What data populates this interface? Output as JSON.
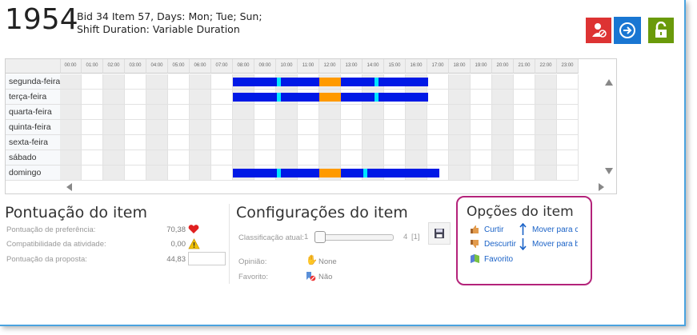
{
  "header": {
    "bid_number": "1954",
    "line1": "Bid 34 Item 57, Days: Mon; Tue; Sun;",
    "line2": "Shift Duration: Variable Duration"
  },
  "schedule": {
    "hours": [
      "00:00",
      "01:00",
      "02:00",
      "03:00",
      "04:00",
      "05:00",
      "06:00",
      "07:00",
      "08:00",
      "09:00",
      "10:00",
      "11:00",
      "12:00",
      "13:00",
      "14:00",
      "15:00",
      "16:00",
      "17:00",
      "18:00",
      "19:00",
      "20:00",
      "21:00",
      "22:00",
      "23:00"
    ],
    "days": [
      "segunda-feira",
      "terça-feira",
      "quarta-feira",
      "quinta-feira",
      "sexta-feira",
      "sábado",
      "domingo"
    ],
    "colors": {
      "work": "#0019e6",
      "break": "#00e5ff",
      "lunch": "#ff9a00"
    }
  },
  "score": {
    "title": "Pontuação do item",
    "rows": [
      {
        "label": "Pontuação de preferência:",
        "value": "70,38",
        "icon": "heart-icon"
      },
      {
        "label": "Compatibilidade da atividade:",
        "value": "0,00",
        "icon": "warning-icon"
      },
      {
        "label": "Pontuação da proposta:",
        "value": "44,83",
        "icon": ""
      }
    ]
  },
  "config": {
    "title": "Configurações do item",
    "rating_label": "Classificação atual:",
    "rating_min": "1",
    "rating_max": "4",
    "rating_value": "[1]",
    "opinion_label": "Opinião:",
    "opinion_value": "None",
    "favorite_label": "Favorito:",
    "favorite_value": "Não"
  },
  "options": {
    "title": "Opções do item",
    "like": "Curtir",
    "dislike": "Descurtir",
    "favorite": "Favorito",
    "move_up": "Mover para c",
    "move_down": "Mover para b"
  }
}
